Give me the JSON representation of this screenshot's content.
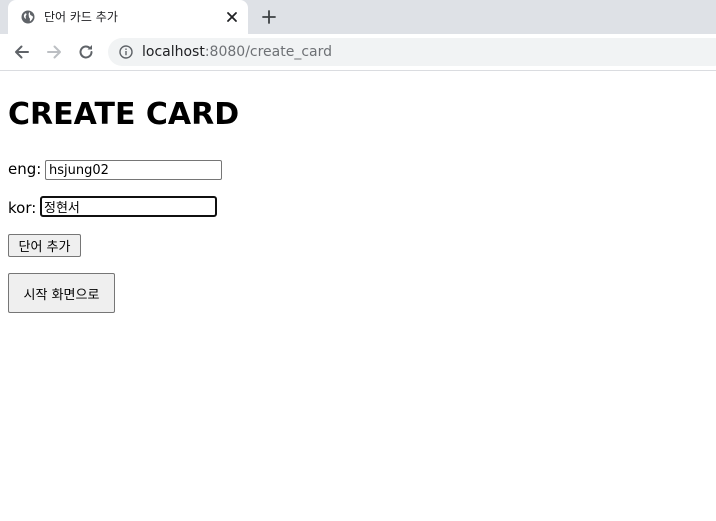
{
  "browser": {
    "tab": {
      "title": "단어 카드 추가",
      "favicon": "globe-icon"
    },
    "address": {
      "host": "localhost",
      "path": ":8080/create_card"
    }
  },
  "page": {
    "heading": "CREATE CARD",
    "form": {
      "eng_label": "eng:",
      "eng_value": "hsjung02",
      "kor_label": "kor:",
      "kor_value": "정현서",
      "submit_label": "단어 추가"
    },
    "home_button_label": "시작 화면으로"
  }
}
